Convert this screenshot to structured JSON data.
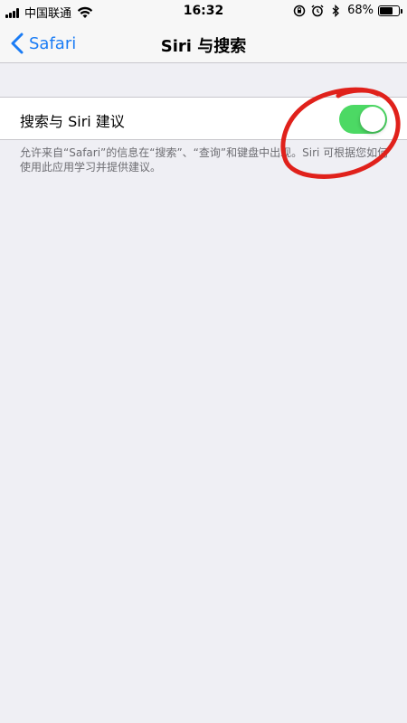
{
  "status_bar": {
    "carrier": "中国联通",
    "time": "16:32",
    "battery_percent": "68%",
    "battery_level": 0.68,
    "icons": [
      "signal-icon",
      "wifi-icon",
      "orientation-lock-icon",
      "alarm-icon",
      "bluetooth-icon",
      "battery-icon"
    ]
  },
  "nav": {
    "back_label": "Safari",
    "title": "Siri 与搜索"
  },
  "settings": {
    "row_label": "搜索与 Siri 建议",
    "toggle_on": true,
    "footnote": "允许来自“Safari”的信息在“搜索”、“查询”和键盘中出现。Siri 可根据您如何使用此应用学习并提供建议。"
  },
  "colors": {
    "accent": "#1a7cf5",
    "toggle_on": "#4cd964",
    "background": "#efeff4",
    "annotation": "#e0211b"
  }
}
